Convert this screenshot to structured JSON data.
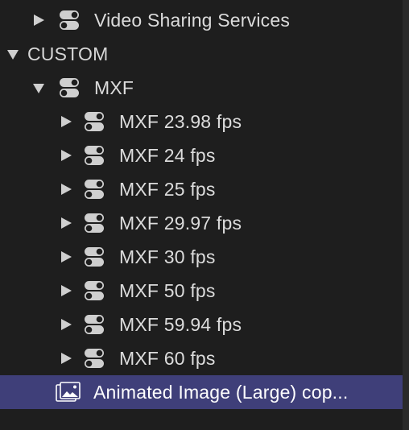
{
  "tree": {
    "video_sharing": {
      "label": "Video Sharing Services",
      "icon": "preset-toggle-icon"
    },
    "custom": {
      "label": "CUSTOM"
    },
    "mxf": {
      "label": "MXF",
      "icon": "preset-toggle-icon"
    },
    "mxf_items": [
      {
        "label": "MXF 23.98 fps"
      },
      {
        "label": "MXF 24 fps"
      },
      {
        "label": "MXF 25 fps"
      },
      {
        "label": "MXF 29.97 fps"
      },
      {
        "label": "MXF 30 fps"
      },
      {
        "label": "MXF 50 fps"
      },
      {
        "label": "MXF 59.94 fps"
      },
      {
        "label": "MXF 60 fps"
      }
    ],
    "selected": {
      "label": "Animated Image (Large) cop...",
      "icon": "image-icon"
    }
  },
  "colors": {
    "background": "#1e1e1e",
    "selection": "#3f3f79",
    "text": "#dcdcdc"
  }
}
